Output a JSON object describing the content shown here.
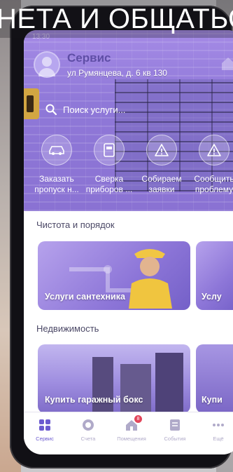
{
  "overlay_caption": "НЕТА И ОБЩАТЬСЯ",
  "status_bar": {
    "time": "13:30"
  },
  "header": {
    "title": "Сервис",
    "address": "ул Румянцева, д. 6 кв 130"
  },
  "search": {
    "placeholder": "Поиск услуги..."
  },
  "quick_actions": [
    {
      "label": "Заказать\nпропуск н...",
      "icon": "car-icon"
    },
    {
      "label": "Сверка\nприборов ...",
      "icon": "meter-icon"
    },
    {
      "label": "Собираем\nзаявки",
      "icon": "warning-icon"
    },
    {
      "label": "Сообщить\nпроблему",
      "icon": "warning-icon"
    }
  ],
  "sections": [
    {
      "title": "Чистота и порядок",
      "cards": [
        {
          "label": "Услуги сантехника"
        },
        {
          "label": "Услу"
        }
      ]
    },
    {
      "title": "Недвижимость",
      "cards": [
        {
          "label": "Купить гаражный бокс"
        },
        {
          "label": "Купи"
        }
      ]
    }
  ],
  "tab_bar": {
    "tabs": [
      {
        "label": "Сервис",
        "icon": "grid-icon",
        "active": true
      },
      {
        "label": "Счета",
        "icon": "coin-icon",
        "active": false
      },
      {
        "label": "Помещения",
        "icon": "house-icon",
        "active": false,
        "badge": "8"
      },
      {
        "label": "События",
        "icon": "news-icon",
        "active": false
      },
      {
        "label": "Ещё",
        "icon": "more-icon",
        "active": false
      }
    ]
  },
  "colors": {
    "accent": "#6b5ad0",
    "hero_overlay": "#8f78d8",
    "badge": "#e2455a",
    "inactive_tab": "#b0aac9"
  }
}
